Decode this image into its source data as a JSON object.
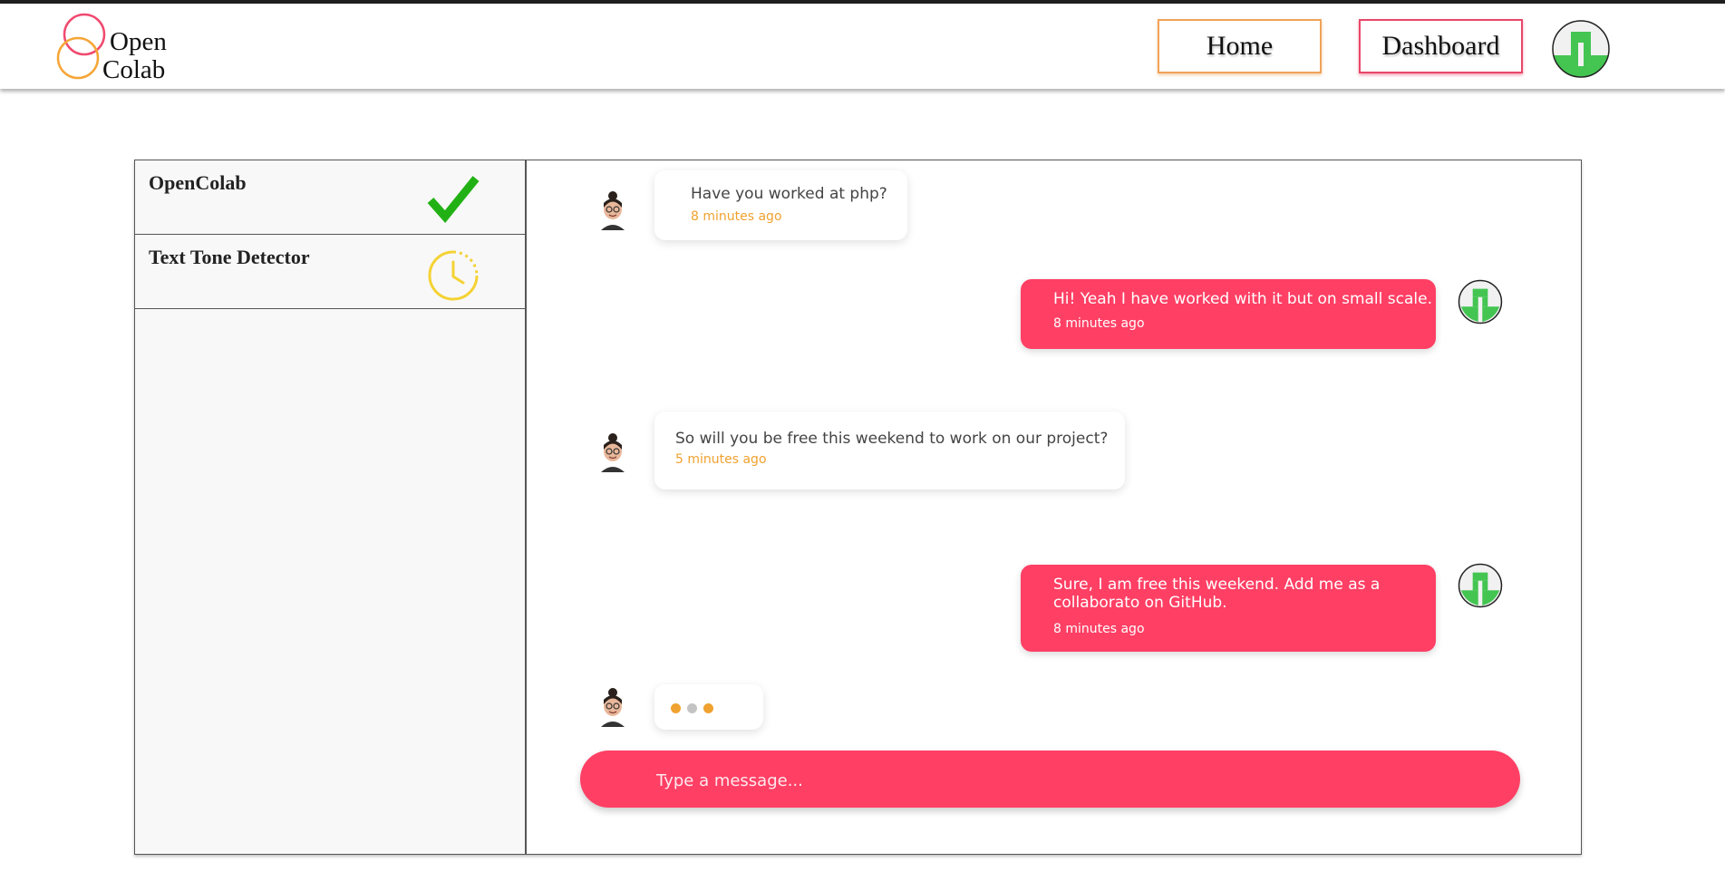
{
  "app": {
    "logo_line1": "Open",
    "logo_line2": "Colab"
  },
  "nav": {
    "home_label": "Home",
    "dashboard_label": "Dashboard",
    "avatar_icon": "green-identicon-icon"
  },
  "sidebar": {
    "projects": [
      {
        "name": "OpenColab",
        "status_icon": "checkmark-icon",
        "status_color": "#22b115"
      },
      {
        "name": "Text Tone Detector",
        "status_icon": "clock-icon",
        "status_color": "#f4d234"
      }
    ]
  },
  "chat": {
    "messages": [
      {
        "side": "incoming",
        "text": "Have you worked at php?",
        "time": "8 minutes ago"
      },
      {
        "side": "outgoing",
        "text": "Hi! Yeah I have worked with it but on small scale.",
        "time": "8 minutes ago"
      },
      {
        "side": "incoming",
        "text": "So will you be free this weekend to work on our project?",
        "time": "5 minutes ago"
      },
      {
        "side": "outgoing",
        "text": "Sure, I am free this weekend. Add me as a collaborato on GitHub.",
        "time": "8 minutes ago"
      }
    ],
    "typing_indicator_colors": [
      "#f0a230",
      "#c4c4c4",
      "#f0a230"
    ],
    "composer_placeholder": "Type a message..."
  },
  "colors": {
    "accent_pink": "#ff3f64",
    "accent_orange": "#f0a230",
    "user_avatar_green": "#44c552"
  }
}
